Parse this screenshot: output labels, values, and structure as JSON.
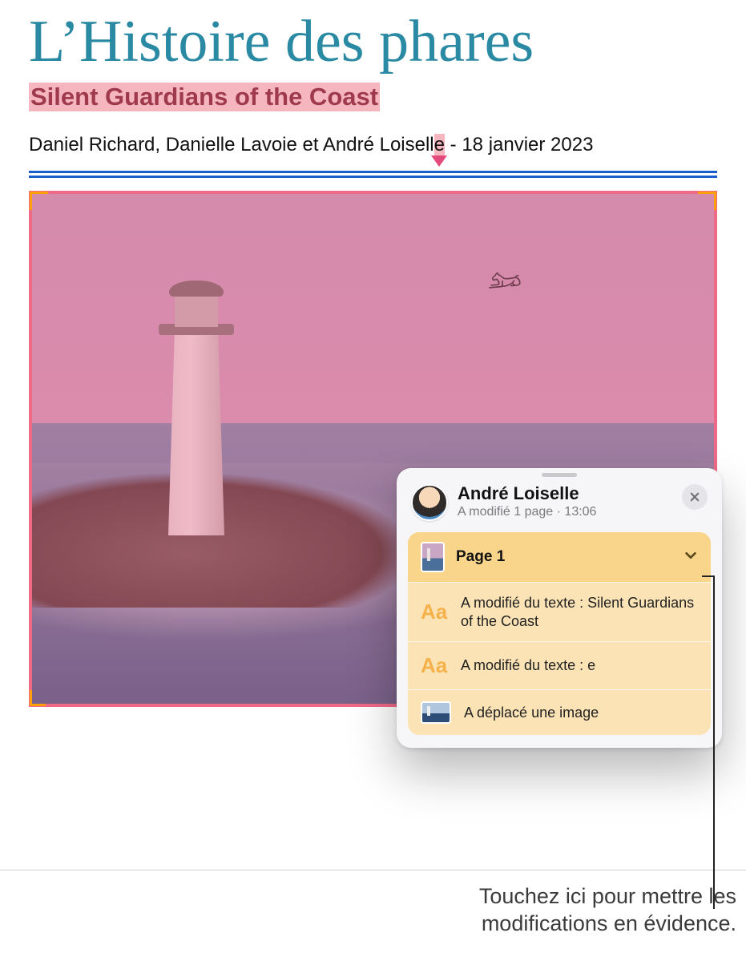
{
  "document": {
    "title": "L’Histoire des phares",
    "subtitle": "Silent Guardians of the Coast",
    "byline_prefix": "Daniel Richard, Danielle Lavoie et André Loisell",
    "byline_marked": "e",
    "byline_suffix": " - 18 janvier 2023"
  },
  "popover": {
    "author": "André Loiselle",
    "summary": "A modifié 1 page · 13:06",
    "page_label": "Page 1",
    "items": [
      {
        "icon": "Aa",
        "text": "A modifié du texte : Silent Guardians of the Coast"
      },
      {
        "icon": "Aa",
        "text": "A modifié du texte : e"
      },
      {
        "icon": "img",
        "text": "A déplacé une image"
      }
    ]
  },
  "callout": {
    "line1": "Touchez ici pour mettre les",
    "line2": "modifications en évidence."
  },
  "icons": {
    "close": "close-icon",
    "chevron": "chevron-down-icon",
    "text_change": "Aa",
    "avatar": "avatar"
  }
}
